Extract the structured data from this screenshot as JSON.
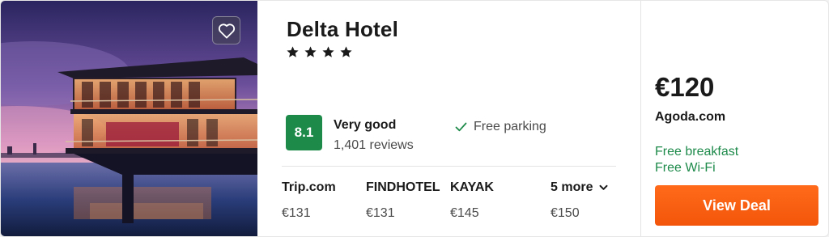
{
  "hotel": {
    "name": "Delta Hotel",
    "star_count": 4,
    "star_glyph": "★"
  },
  "rating": {
    "score": "8.1",
    "label": "Very good",
    "reviews": "1,401 reviews",
    "badge_color": "#1d8a4a"
  },
  "amenity": {
    "icon": "check-icon",
    "label": "Free parking"
  },
  "providers": [
    {
      "name": "Trip.com",
      "price": "€131"
    },
    {
      "name": "FINDHOTEL",
      "price": "€131"
    },
    {
      "name": "KAYAK",
      "price": "€145"
    }
  ],
  "more": {
    "label": "5 more",
    "icon": "chevron-down-icon",
    "price": "€150"
  },
  "deal": {
    "price": "€120",
    "site": "Agoda.com",
    "perks": [
      "Free breakfast",
      "Free Wi-Fi"
    ],
    "button_label": "View Deal",
    "button_color": "#f3560a",
    "perk_color": "#1d8a4a"
  },
  "photo": {
    "favorite_icon": "heart-icon"
  }
}
